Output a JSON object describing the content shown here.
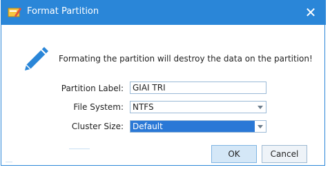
{
  "window": {
    "title": "Format Partition",
    "close_label": "✕"
  },
  "message": "Formating the partition will destroy the data on the partition!",
  "form": {
    "partition_label": {
      "label": "Partition Label:",
      "value": "GIAI TRI"
    },
    "file_system": {
      "label": "File System:",
      "value": "NTFS"
    },
    "cluster_size": {
      "label": "Cluster Size:",
      "value": "Default"
    }
  },
  "buttons": {
    "ok": "OK",
    "cancel": "Cancel"
  },
  "colors": {
    "titlebar": "#2a86d8",
    "selection": "#2a78d6"
  },
  "icons": {
    "app": "format-partition-icon",
    "message": "pencil-icon",
    "dropdown": "chevron-down-icon"
  }
}
